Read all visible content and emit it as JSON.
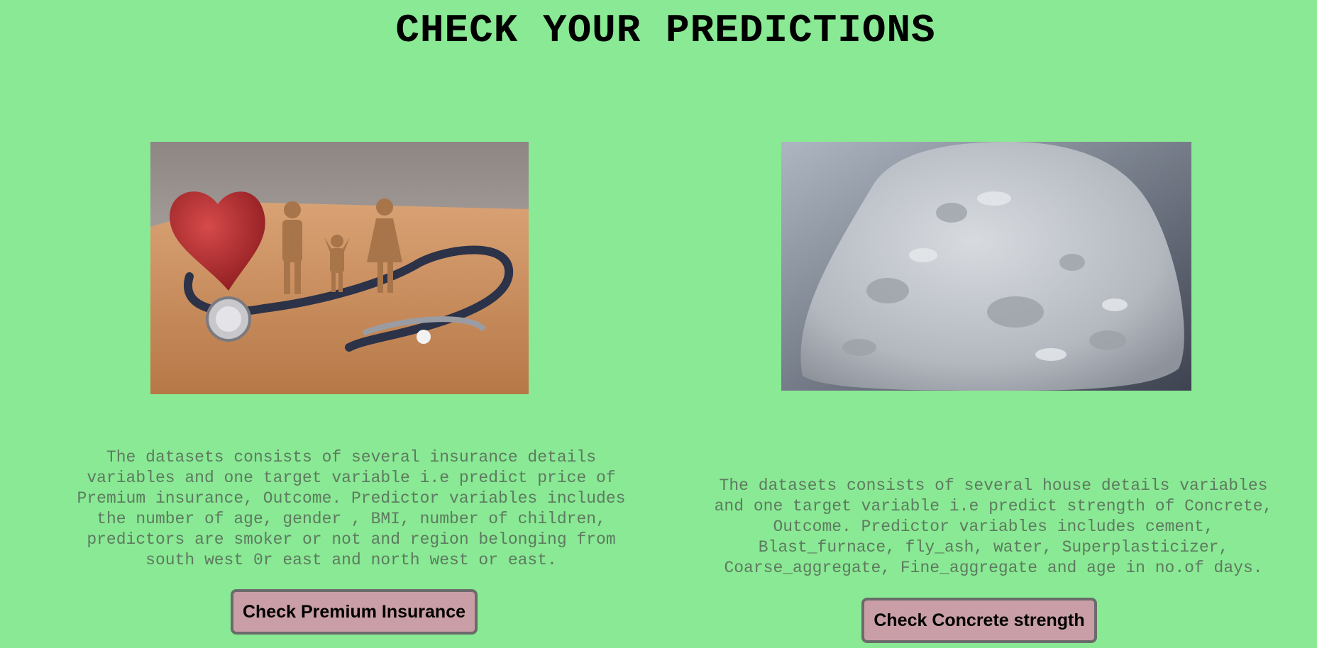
{
  "page": {
    "title": "CHECK YOUR PREDICTIONS",
    "background_color": "#89e994"
  },
  "cards": [
    {
      "image_icon": "insurance-family-stethoscope-photo",
      "description": "The datasets consists of several insurance details\nvariables and one target variable i.e predict price of\nPremium insurance, Outcome. Predictor variables includes\nthe number of age, gender , BMI, number of children,\npredictors are smoker or not and region belonging from\nsouth west 0r east and north west or east.",
      "button_label": "Check Premium Insurance"
    },
    {
      "image_icon": "concrete-cement-powder-photo",
      "description": "The datasets consists of several house details variables\nand one target variable i.e predict strength of Concrete,\nOutcome. Predictor variables includes cement,\nBlast_furnace, fly_ash, water, Superplasticizer,\nCoarse_aggregate, Fine_aggregate and age in no.of days.",
      "button_label": "Check Concrete strength"
    }
  ],
  "colors": {
    "button_bg": "#c99ea6",
    "button_border": "#6b6b6b",
    "description_text": "#5e7a60"
  }
}
